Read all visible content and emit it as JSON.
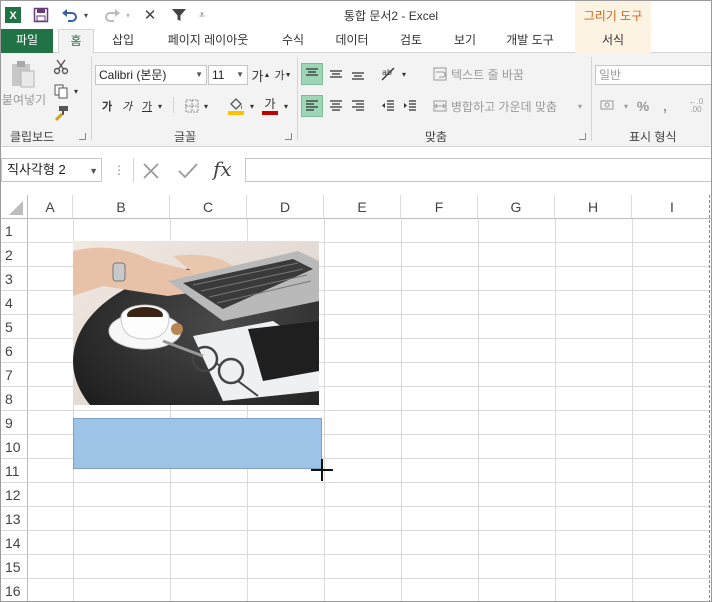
{
  "titlebar": {
    "title": "통합 문서2 - Excel",
    "context_group": "그리기 도구",
    "app_icon_label": "X"
  },
  "tabs": [
    {
      "label": "파일"
    },
    {
      "label": "홈"
    },
    {
      "label": "삽입"
    },
    {
      "label": "페이지 레이아웃"
    },
    {
      "label": "수식"
    },
    {
      "label": "데이터"
    },
    {
      "label": "검토"
    },
    {
      "label": "보기"
    },
    {
      "label": "개발 도구"
    },
    {
      "label": "서식"
    }
  ],
  "ribbon": {
    "clipboard": {
      "label": "클립보드",
      "paste_label": "붙여넣기"
    },
    "font": {
      "label": "글꼴",
      "font_name": "Calibri (본문)",
      "font_size": "11",
      "bold": "가",
      "italic": "가",
      "underline": "가",
      "font_color_glyph": "가"
    },
    "alignment": {
      "label": "맞춤",
      "wrap_text": "텍스트 줄 바꿈",
      "merge_center": "병합하고 가운데 맞춤"
    },
    "number": {
      "label": "표시 형식",
      "format": "일반",
      "percent": "%"
    }
  },
  "formula_bar": {
    "name_box": "직사각형 2",
    "fx_label": "fx",
    "formula": ""
  },
  "sheet": {
    "columns": [
      "A",
      "B",
      "C",
      "D",
      "E",
      "F",
      "G",
      "H",
      "I"
    ],
    "rows": [
      "1",
      "2",
      "3",
      "4",
      "5",
      "6",
      "7",
      "8",
      "9",
      "10",
      "11",
      "12",
      "13",
      "14",
      "15",
      "16"
    ]
  },
  "colors": {
    "accent": "#217346",
    "context": "#d2651b",
    "shape_fill": "#9dc3e6"
  }
}
